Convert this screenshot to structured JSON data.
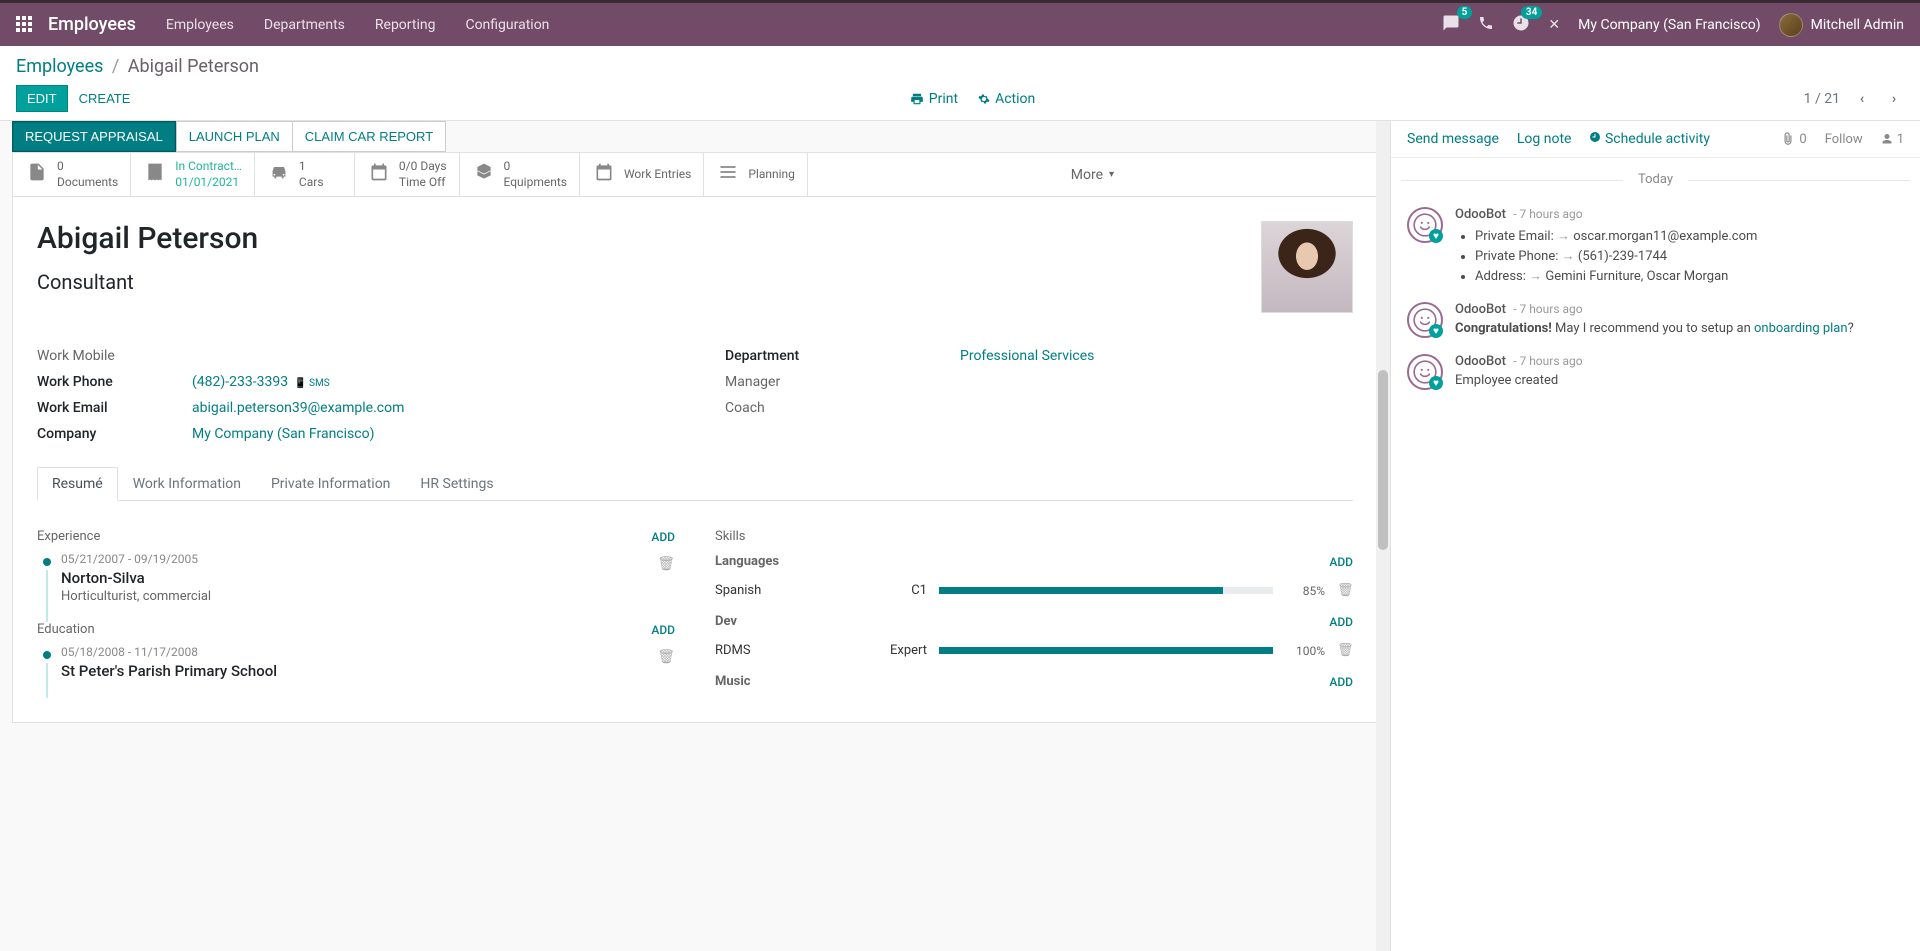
{
  "nav": {
    "brand": "Employees",
    "menu": [
      "Employees",
      "Departments",
      "Reporting",
      "Configuration"
    ],
    "msg_badge": "5",
    "clock_badge": "34",
    "company": "My Company (San Francisco)",
    "user": "Mitchell Admin"
  },
  "breadcrumb": {
    "root": "Employees",
    "current": "Abigail Peterson"
  },
  "buttons": {
    "edit": "EDIT",
    "create": "CREATE",
    "print": "Print",
    "action": "Action"
  },
  "pager": {
    "text": "1 / 21"
  },
  "actions": {
    "request_appraisal": "REQUEST APPRAISAL",
    "launch_plan": "LAUNCH PLAN",
    "claim_car": "CLAIM CAR REPORT"
  },
  "stats": {
    "documents": {
      "val": "0",
      "label": "Documents"
    },
    "contract": {
      "val": "In Contract…",
      "date": "01/01/2021"
    },
    "cars": {
      "val": "1",
      "label": "Cars"
    },
    "timeoff": {
      "val": "0/0 Days",
      "label": "Time Off"
    },
    "equip": {
      "val": "0",
      "label": "Equipments"
    },
    "workentries": "Work Entries",
    "planning": "Planning",
    "more": "More"
  },
  "employee": {
    "name": "Abigail Peterson",
    "title": "Consultant"
  },
  "fields": {
    "left": {
      "work_mobile": {
        "label": "Work Mobile",
        "value": ""
      },
      "work_phone": {
        "label": "Work Phone",
        "value": "(482)-233-3393",
        "sms": "SMS"
      },
      "work_email": {
        "label": "Work Email",
        "value": "abigail.peterson39@example.com"
      },
      "company": {
        "label": "Company",
        "value": "My Company (San Francisco)"
      }
    },
    "right": {
      "department": {
        "label": "Department",
        "value": "Professional Services"
      },
      "manager": {
        "label": "Manager",
        "value": ""
      },
      "coach": {
        "label": "Coach",
        "value": ""
      }
    }
  },
  "tabs": [
    "Resumé",
    "Work Information",
    "Private Information",
    "HR Settings"
  ],
  "resume": {
    "experience_label": "Experience",
    "education_label": "Education",
    "add": "ADD",
    "items": [
      {
        "dates": "05/21/2007 - 09/19/2005",
        "title": "Norton-Silva",
        "sub": "Horticulturist, commercial"
      }
    ],
    "education": [
      {
        "dates": "05/18/2008 - 11/17/2008",
        "title": "St Peter's Parish Primary School"
      }
    ]
  },
  "skills": {
    "header": "Skills",
    "groups": [
      {
        "name": "Languages",
        "items": [
          {
            "name": "Spanish",
            "level": "C1",
            "pct": 85
          }
        ]
      },
      {
        "name": "Dev",
        "items": [
          {
            "name": "RDMS",
            "level": "Expert",
            "pct": 100
          }
        ]
      },
      {
        "name": "Music",
        "items": []
      }
    ]
  },
  "chatter": {
    "send": "Send message",
    "log": "Log note",
    "schedule": "Schedule activity",
    "attach_count": "0",
    "follow": "Follow",
    "follower_count": "1",
    "today": "Today",
    "messages": [
      {
        "author": "OdooBot",
        "time": "- 7 hours ago",
        "bullets": [
          {
            "label": "Private Email:",
            "value": "oscar.morgan11@example.com"
          },
          {
            "label": "Private Phone:",
            "value": "(561)-239-1744"
          },
          {
            "label": "Address:",
            "value": "Gemini Furniture, Oscar Morgan"
          }
        ]
      },
      {
        "author": "OdooBot",
        "time": "- 7 hours ago",
        "html": {
          "pre": "Congratulations!",
          "text": " May I recommend you to setup an ",
          "link": "onboarding plan",
          "post": "?"
        }
      },
      {
        "author": "OdooBot",
        "time": "- 7 hours ago",
        "text": "Employee created"
      }
    ]
  }
}
